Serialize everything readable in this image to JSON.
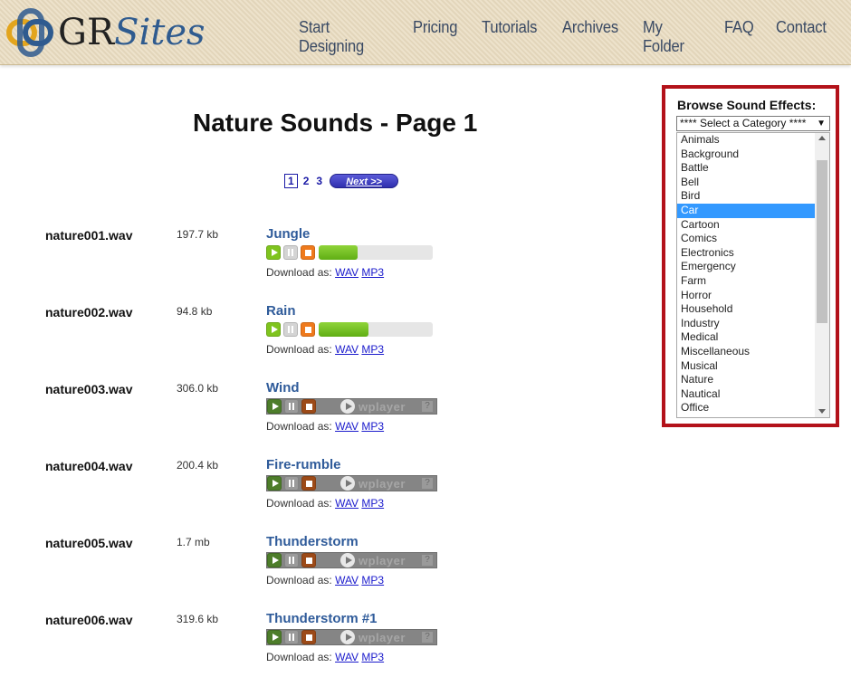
{
  "brand": {
    "gr": "GR",
    "sites": "Sites",
    "logo_icon": "interlocked-rings-logo-icon",
    "colors": {
      "gold": "#e3a51d",
      "blue": "#2f5b8f"
    }
  },
  "nav": [
    "Start Designing",
    "Pricing",
    "Tutorials",
    "Archives",
    "My Folder",
    "FAQ",
    "Contact"
  ],
  "page_title": "Nature Sounds - Page 1",
  "pager": {
    "current": "1",
    "pages": [
      "2",
      "3"
    ],
    "next": "Next >>"
  },
  "download_label": "Download as:",
  "formats": [
    "WAV",
    "MP3"
  ],
  "flash_player_label": "wplayer",
  "flash_help": "?",
  "sounds": [
    {
      "file": "nature001.wav",
      "size": "197.7 kb",
      "title": "Jungle",
      "player": "html5",
      "progress": 0.34
    },
    {
      "file": "nature002.wav",
      "size": "94.8 kb",
      "title": "Rain",
      "player": "html5",
      "progress": 0.44
    },
    {
      "file": "nature003.wav",
      "size": "306.0 kb",
      "title": "Wind",
      "player": "flash"
    },
    {
      "file": "nature004.wav",
      "size": "200.4 kb",
      "title": "Fire-rumble",
      "player": "flash"
    },
    {
      "file": "nature005.wav",
      "size": "1.7 mb",
      "title": "Thunderstorm",
      "player": "flash"
    },
    {
      "file": "nature006.wav",
      "size": "319.6 kb",
      "title": "Thunderstorm #1",
      "player": "flash"
    }
  ],
  "browse": {
    "title": "Browse Sound Effects:",
    "select_placeholder": "**** Select a Category ****",
    "selected": "Car",
    "categories": [
      "Animals",
      "Background",
      "Battle",
      "Bell",
      "Bird",
      "Car",
      "Cartoon",
      "Comics",
      "Electronics",
      "Emergency",
      "Farm",
      "Horror",
      "Household",
      "Industry",
      "Medical",
      "Miscellaneous",
      "Musical",
      "Nature",
      "Nautical",
      "Office"
    ],
    "border_color": "#b3121a",
    "highlight_color": "#3399ff"
  }
}
